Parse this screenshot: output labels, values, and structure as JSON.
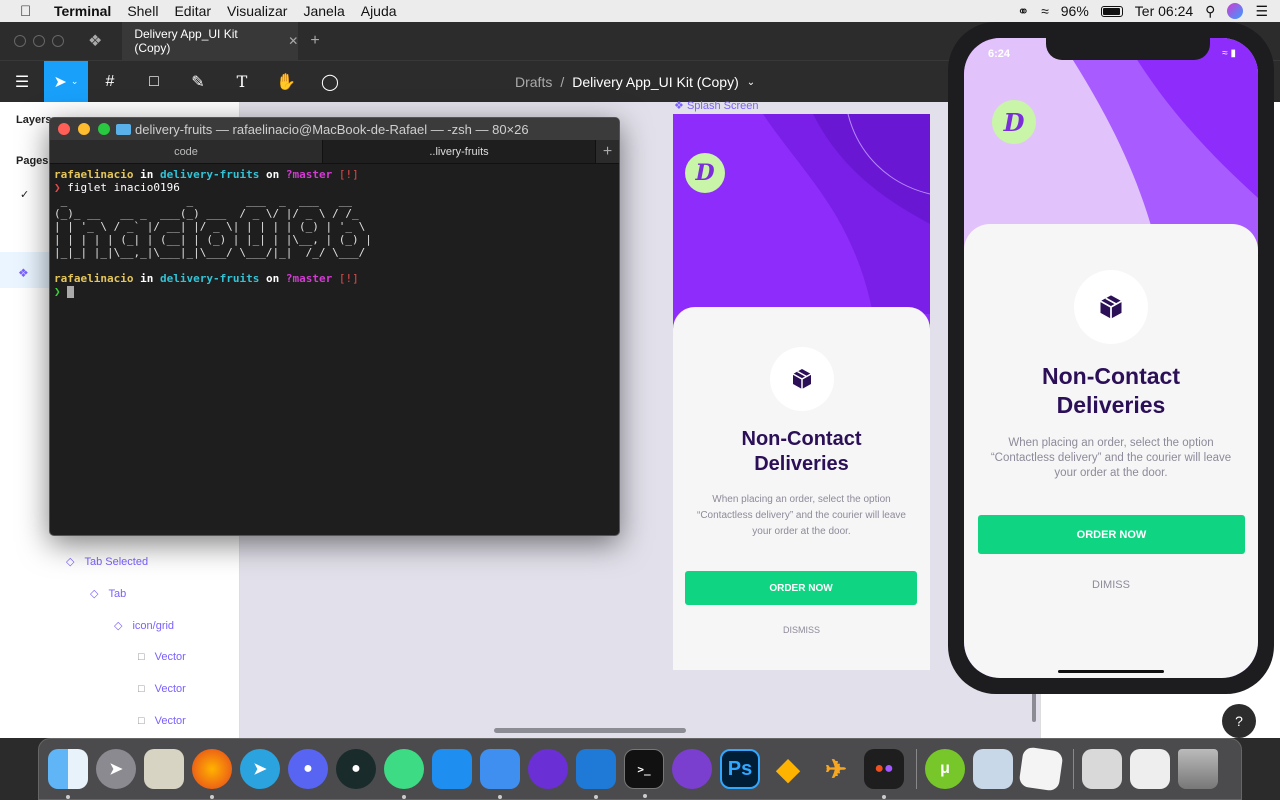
{
  "menubar": {
    "app_name": "Terminal",
    "items": [
      "Shell",
      "Editar",
      "Visualizar",
      "Janela",
      "Ajuda"
    ],
    "battery": "96%",
    "clock": "Ter 06:24"
  },
  "figma": {
    "tab_title": "Delivery App_UI Kit (Copy)",
    "breadcrumb_parent": "Drafts",
    "breadcrumb_separator": "/",
    "breadcrumb_current": "Delivery App_UI Kit (Copy)",
    "left_panel": {
      "layers_label": "Layers",
      "pages_label": "Pages",
      "layers": [
        {
          "label": "Tab Selected",
          "icon": "component-instance-icon"
        },
        {
          "label": "Tab",
          "icon": "component-instance-icon"
        },
        {
          "label": "icon/grid",
          "icon": "component-instance-icon"
        },
        {
          "label": "Vector",
          "icon": "vector-icon"
        },
        {
          "label": "Vector",
          "icon": "vector-icon"
        },
        {
          "label": "Vector",
          "icon": "vector-icon"
        }
      ]
    },
    "frame_label": "Splash Screen",
    "help": "?"
  },
  "splash_frame": {
    "logo": "D",
    "title_line1": "Non-Contact",
    "title_line2": "Deliveries",
    "description": "When placing an order, select the option “Contactless delivery” and the courier will leave your order at the door.",
    "button": "ORDER NOW",
    "dismiss": "DISMISS"
  },
  "phone": {
    "time": "6:24",
    "logo": "D",
    "title_line1": "Non-Contact",
    "title_line2": "Deliveries",
    "description": "When placing an order, select the option “Contactless delivery” and the courier will leave your order at the door.",
    "button": "ORDER NOW",
    "dismiss": "DIMISS"
  },
  "terminal": {
    "title": "delivery-fruits — rafaelinacio@MacBook-de-Rafael — -zsh — 80×26",
    "tabs": [
      "code",
      "..livery-fruits"
    ],
    "prompt_user": "rafaelinacio",
    "prompt_in": " in ",
    "prompt_dir": "delivery-fruits",
    "prompt_on": " on ",
    "prompt_branch_icon": "?",
    "prompt_branch": "master",
    "prompt_status": " [!]",
    "command": "figlet inacio0196",
    "figlet_lines": [
      " _                  _        ___  _  ___   __   ",
      "(_)_ __   __ _  ___(_) ___  / _ \\/ |/ _ \\ / /_  ",
      "| | '_ \\ / _` |/ __| |/ _ \\| | | | | (_) | '_ \\ ",
      "| | | | | (_| | (__| | (_) | |_| | |\\__, | (_) |",
      "|_|_| |_|\\__,_|\\___|_|\\___/ \\___/|_|  /_/ \\___/ "
    ]
  },
  "dock": {
    "apps": [
      "Finder",
      "Launchpad",
      "Script Editor",
      "Firefox",
      "Telegram",
      "Discord",
      "GitKraken",
      "Android Studio",
      "Xcode",
      "Simulator",
      "Alto's",
      "Visual Studio Code",
      "Terminal",
      "Insomnia",
      "Photoshop",
      "Sketch",
      "Airmail",
      "Figma",
      "uTorrent",
      "Preview",
      "TextEdit",
      "Downloads",
      "Documents",
      "Trash"
    ],
    "ps_label": "Ps",
    "terminal_glyph": ">_"
  },
  "colors": {
    "purple": "#8e2dfb",
    "green": "#0fd582",
    "figma_blue": "#18a0fb",
    "title": "#2b0f57"
  }
}
